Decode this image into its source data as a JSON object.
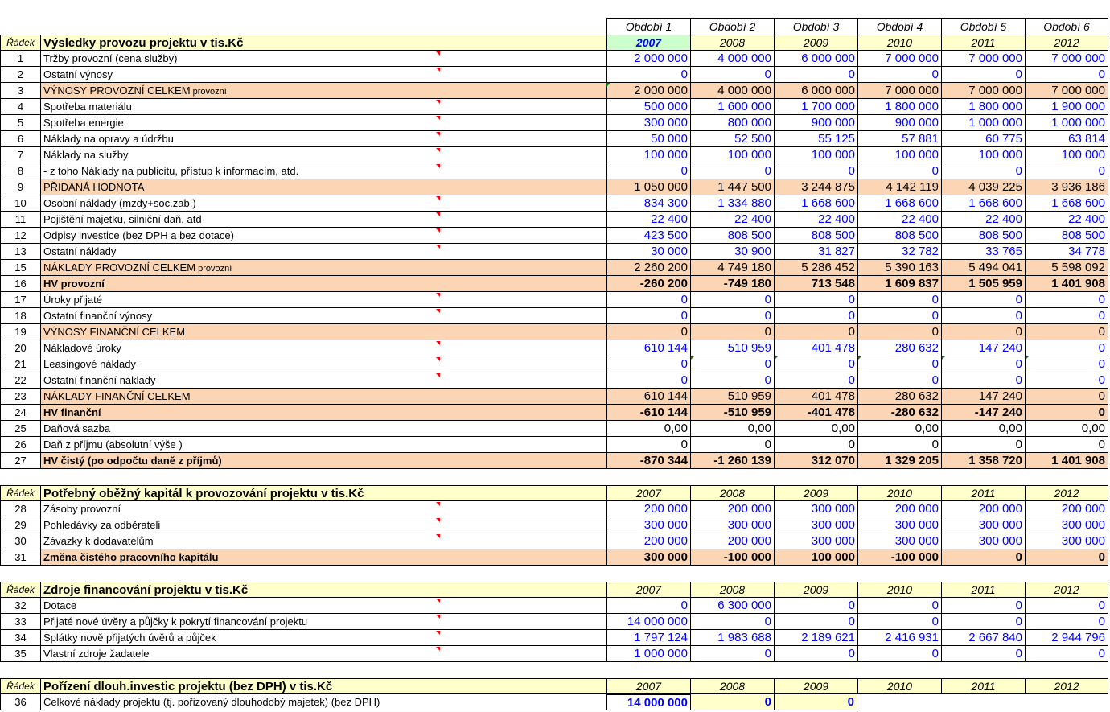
{
  "periods": [
    "Období 1",
    "Období 2",
    "Období 3",
    "Období 4",
    "Období 5",
    "Období 6"
  ],
  "years": [
    "2007",
    "2008",
    "2009",
    "2010",
    "2011",
    "2012"
  ],
  "radek_label": "Řádek",
  "sections": [
    {
      "title": "Výsledky provozu projektu v  tis.Kč",
      "rows": [
        {
          "no": "1",
          "label": "Tržby provozní (cena služby)",
          "style": "input",
          "values": [
            "2 000 000",
            "4 000 000",
            "6 000 000",
            "7 000 000",
            "7 000 000",
            "7 000 000"
          ]
        },
        {
          "no": "2",
          "label": "Ostatní výnosy",
          "style": "input",
          "values": [
            "0",
            "0",
            "0",
            "0",
            "0",
            "0"
          ]
        },
        {
          "no": "3",
          "label": "VÝNOSY PROVOZNÍ CELKEM",
          "suffix": " provozní",
          "style": "total",
          "values": [
            "2 000 000",
            "4 000 000",
            "6 000 000",
            "7 000 000",
            "7 000 000",
            "7 000 000"
          ]
        },
        {
          "no": "4",
          "label": "Spotřeba materiálu",
          "style": "input",
          "values": [
            "500 000",
            "1 600 000",
            "1 700 000",
            "1 800 000",
            "1 800 000",
            "1 900 000"
          ]
        },
        {
          "no": "5",
          "label": "Spotřeba energie",
          "style": "input",
          "values": [
            "300 000",
            "800 000",
            "900 000",
            "900 000",
            "1 000 000",
            "1 000 000"
          ]
        },
        {
          "no": "6",
          "label": "Náklady na opravy a údržbu",
          "style": "input",
          "values": [
            "50 000",
            "52 500",
            "55 125",
            "57 881",
            "60 775",
            "63 814"
          ]
        },
        {
          "no": "7",
          "label": "Náklady na služby",
          "style": "input",
          "values": [
            "100 000",
            "100 000",
            "100 000",
            "100 000",
            "100 000",
            "100 000"
          ]
        },
        {
          "no": "8",
          "label": " - z toho Náklady na publicitu, přístup k informacím, atd.",
          "style": "input",
          "values": [
            "0",
            "0",
            "0",
            "0",
            "0",
            "0"
          ]
        },
        {
          "no": "9",
          "label": "PŘIDANÁ HODNOTA",
          "style": "total",
          "values": [
            "1 050 000",
            "1 447 500",
            "3 244 875",
            "4 142 119",
            "4 039 225",
            "3 936 186"
          ]
        },
        {
          "no": "10",
          "label": "Osobní náklady (mzdy+soc.zab.)",
          "style": "input",
          "values": [
            "834 300",
            "1 334 880",
            "1 668 600",
            "1 668 600",
            "1 668 600",
            "1 668 600"
          ]
        },
        {
          "no": "11",
          "label": "Pojištění majetku, silniční daň, atd",
          "style": "input",
          "values": [
            "22 400",
            "22 400",
            "22 400",
            "22 400",
            "22 400",
            "22 400"
          ]
        },
        {
          "no": "12",
          "label": "Odpisy investice (bez DPH a bez dotace)",
          "style": "input",
          "values": [
            "423 500",
            "808 500",
            "808 500",
            "808 500",
            "808 500",
            "808 500"
          ]
        },
        {
          "no": "13",
          "label": "Ostatní náklady",
          "style": "input",
          "values": [
            "30 000",
            "30 900",
            "31 827",
            "32 782",
            "33 765",
            "34 778"
          ]
        },
        {
          "no": "15",
          "label": "NÁKLADY PROVOZNÍ CELKEM",
          "suffix": " provozní",
          "style": "total",
          "values": [
            "2 260 200",
            "4 749 180",
            "5 286 452",
            "5 390 163",
            "5 494 041",
            "5 598 092"
          ]
        },
        {
          "no": "16",
          "label": "HV provozní",
          "style": "bold",
          "values": [
            "-260 200",
            "-749 180",
            "713 548",
            "1 609 837",
            "1 505 959",
            "1 401 908"
          ]
        },
        {
          "no": "17",
          "label": "Úroky přijaté",
          "style": "input",
          "values": [
            "0",
            "0",
            "0",
            "0",
            "0",
            "0"
          ]
        },
        {
          "no": "18",
          "label": "Ostatní finanční výnosy",
          "style": "input",
          "values": [
            "0",
            "0",
            "0",
            "0",
            "0",
            "0"
          ]
        },
        {
          "no": "19",
          "label": "VÝNOSY FINANČNÍ CELKEM",
          "style": "total",
          "values": [
            "0",
            "0",
            "0",
            "0",
            "0",
            "0"
          ]
        },
        {
          "no": "20",
          "label": "Nákladové úroky",
          "style": "input",
          "values": [
            "610 144",
            "510 959",
            "401 478",
            "280 632",
            "147 240",
            "0"
          ]
        },
        {
          "no": "21",
          "label": "Leasingové náklady",
          "style": "input",
          "values": [
            "0",
            "0",
            "0",
            "0",
            "0",
            "0"
          ]
        },
        {
          "no": "22",
          "label": "Ostatní finanční náklady",
          "style": "input",
          "values": [
            "0",
            "0",
            "0",
            "0",
            "0",
            "0"
          ]
        },
        {
          "no": "23",
          "label": "NÁKLADY FINANČNÍ CELKEM",
          "style": "total",
          "values": [
            "610 144",
            "510 959",
            "401 478",
            "280 632",
            "147 240",
            "0"
          ]
        },
        {
          "no": "24",
          "label": "HV finanční",
          "style": "bold",
          "values": [
            "-610 144",
            "-510 959",
            "-401 478",
            "-280 632",
            "-147 240",
            "0"
          ]
        },
        {
          "no": "25",
          "label": "Daňová sazba",
          "style": "plain",
          "values": [
            "0,00",
            "0,00",
            "0,00",
            "0,00",
            "0,00",
            "0,00"
          ]
        },
        {
          "no": "26",
          "label": "Daň z příjmu (absolutní výše )",
          "style": "plain",
          "values": [
            "0",
            "0",
            "0",
            "0",
            "0",
            "0"
          ]
        },
        {
          "no": "27",
          "label": "HV čistý (po odpočtu daně z příjmů)",
          "style": "bold",
          "values": [
            "-870 344",
            "-1 260 139",
            "312 070",
            "1 329 205",
            "1 358 720",
            "1 401 908"
          ]
        }
      ]
    },
    {
      "title": "Potřebný oběžný kapitál k provozování projektu v tis.Kč",
      "rows": [
        {
          "no": "28",
          "label": "Zásoby provozní",
          "style": "input",
          "values": [
            "200 000",
            "200 000",
            "300 000",
            "200 000",
            "200 000",
            "200 000"
          ]
        },
        {
          "no": "29",
          "label": "Pohledávky za odběrateli",
          "style": "input",
          "values": [
            "300 000",
            "300 000",
            "300 000",
            "300 000",
            "300 000",
            "300 000"
          ]
        },
        {
          "no": "30",
          "label": "Závazky k dodavatelům",
          "style": "input",
          "values": [
            "200 000",
            "200 000",
            "300 000",
            "300 000",
            "300 000",
            "300 000"
          ]
        },
        {
          "no": "31",
          "label": "Změna čistého pracovního kapitálu",
          "style": "bold",
          "values": [
            "300 000",
            "-100 000",
            "100 000",
            "-100 000",
            "0",
            "0"
          ]
        }
      ]
    },
    {
      "title": "Zdroje financování projektu v tis.Kč",
      "rows": [
        {
          "no": "32",
          "label": "Dotace",
          "style": "input",
          "values": [
            "0",
            "6 300 000",
            "0",
            "0",
            "0",
            "0"
          ]
        },
        {
          "no": "33",
          "label": "Přijaté nové úvěry a půjčky k pokrytí financování projektu",
          "style": "input",
          "values": [
            "14 000 000",
            "0",
            "0",
            "0",
            "0",
            "0"
          ]
        },
        {
          "no": "34",
          "label": "Splátky nově přijatých úvěrů a půjček",
          "style": "input",
          "values": [
            "1 797 124",
            "1 983 688",
            "2 189 621",
            "2 416 931",
            "2 667 840",
            "2 944 796"
          ]
        },
        {
          "no": "35",
          "label": "Vlastní zdroje žadatele",
          "style": "input",
          "values": [
            "1 000 000",
            "0",
            "0",
            "0",
            "0",
            "0"
          ]
        }
      ]
    },
    {
      "title": "Pořízení dlouh.investic projektu (bez DPH) v tis.Kč",
      "rows": [
        {
          "no": "36",
          "label": "Celkové náklady projektu (tj. pořizovaný dlouhodobý majetek) (bez DPH)",
          "style": "invest",
          "values": [
            "14 000 000",
            "0",
            "0"
          ]
        }
      ]
    }
  ],
  "colors": {
    "yellow": "#ffffcc",
    "orange": "#fcd5b4",
    "selected_year": "#ccffcc",
    "input_text": "#0000ff",
    "comment_marker": "#ff0000",
    "error_marker": "#008000"
  }
}
